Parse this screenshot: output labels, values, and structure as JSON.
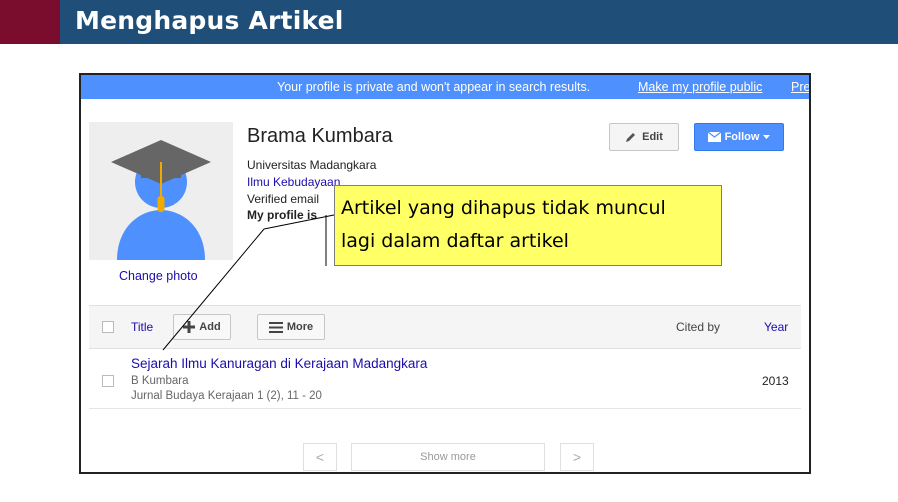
{
  "slide": {
    "title": "Menghapus Artikel"
  },
  "notice": {
    "message": "Your profile is private and won't appear in search results.",
    "make_public_link": "Make my profile public",
    "truncated_link": "Pre"
  },
  "profile": {
    "name": "Brama Kumbara",
    "affiliation": "Universitas Madangkara",
    "interest": "Ilmu Kebudayaan",
    "email_status": "Verified email",
    "visibility_status": "My profile is",
    "change_photo": "Change photo",
    "edit_button": "Edit",
    "follow_button": "Follow"
  },
  "table": {
    "col_title": "Title",
    "add_button": "Add",
    "more_button": "More",
    "col_cited_by": "Cited by",
    "col_year": "Year"
  },
  "articles": [
    {
      "title": "Sejarah Ilmu Kanuragan di Kerajaan Madangkara",
      "authors": "B Kumbara",
      "venue": "Jurnal Budaya Kerajaan 1 (2), 11 - 20",
      "year": "2013"
    }
  ],
  "pager": {
    "prev": "<",
    "show_more": "Show more",
    "next": ">"
  },
  "callout": {
    "line1": "Artikel yang dihapus tidak muncul",
    "line2": "lagi dalam daftar artikel"
  },
  "colors": {
    "slide_header": "#1f4e79",
    "slide_accent": "#7a0c2e",
    "notice_bar": "#4d90fe",
    "link": "#1a0dab",
    "callout_fill": "#ffff66"
  },
  "icons": [
    "graduation-cap-avatar-icon",
    "pencil-icon",
    "envelope-icon",
    "caret-down-icon",
    "plus-icon",
    "menu-icon",
    "chevron-left-icon",
    "chevron-right-icon"
  ]
}
